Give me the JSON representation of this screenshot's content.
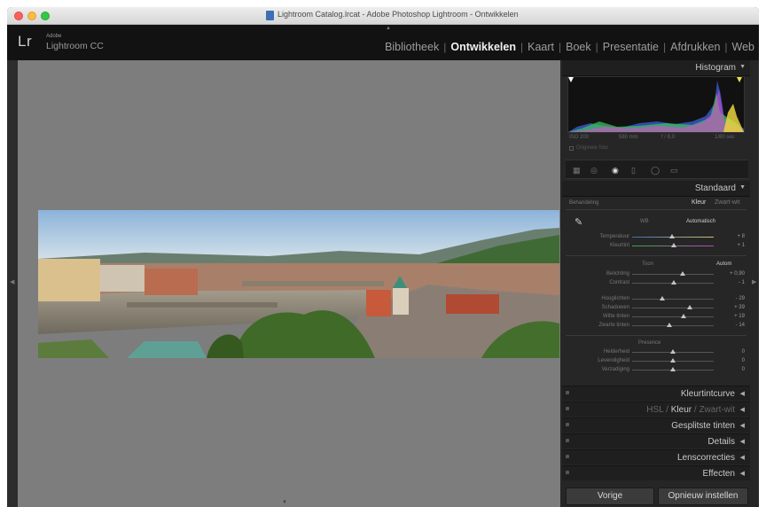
{
  "window": {
    "title": "Lightroom Catalog.lrcat - Adobe Photoshop Lightroom - Ontwikkelen"
  },
  "header": {
    "logo": "Lr",
    "adobe": "Adobe",
    "product": "Lightroom CC",
    "modules": [
      "Bibliotheek",
      "Ontwikkelen",
      "Kaart",
      "Boek",
      "Presentatie",
      "Afdrukken",
      "Web"
    ],
    "active_module": "Ontwikkelen"
  },
  "histogram": {
    "title": "Histogram",
    "iso": "ISO 200",
    "focal": "580 mm",
    "aperture": "f / 8,0",
    "shutter": "1/80 sec",
    "original_label": "Originele foto"
  },
  "basic": {
    "title": "Standaard",
    "treatment_label": "Behandeling",
    "color": "Kleur",
    "bw": "Zwart-wit",
    "wb_label": "WB",
    "wb_value": "Automatisch",
    "temperature": {
      "label": "Temperatuur",
      "value": "+ 8"
    },
    "tint": {
      "label": "Kleurtint",
      "value": "+ 1"
    },
    "tone_label": "Toon",
    "auto": "Autom",
    "exposure": {
      "label": "Belichting",
      "value": "+ 0,90"
    },
    "contrast": {
      "label": "Contrast",
      "value": "- 1"
    },
    "highlights": {
      "label": "Hooglichten",
      "value": "- 29"
    },
    "shadows": {
      "label": "Schaduwen",
      "value": "+ 39"
    },
    "whites": {
      "label": "Witte tinten",
      "value": "+ 19"
    },
    "blacks": {
      "label": "Zwarte tinten",
      "value": "- 14"
    },
    "presence_label": "Presence",
    "clarity": {
      "label": "Helderheid",
      "value": "0"
    },
    "vibrance": {
      "label": "Levendigheid",
      "value": "0"
    },
    "saturation": {
      "label": "Verzadiging",
      "value": "0"
    }
  },
  "panels": {
    "tone_curve": "Kleurtintcurve",
    "hsl": "HSL",
    "color": "Kleur",
    "bw": "Zwart-wit",
    "split_toning": "Gesplitste tinten",
    "details": "Details",
    "lens": "Lenscorrecties",
    "effects": "Effecten"
  },
  "footer": {
    "previous": "Vorige",
    "reset": "Opnieuw instellen"
  },
  "colors": {
    "titlebar": "#e2e2e2",
    "header": "#121212",
    "canvas": "#7d7d7d",
    "panel": "#262626",
    "close": "#fc605c",
    "minimize": "#fdbc40",
    "maximize": "#34c84a"
  }
}
